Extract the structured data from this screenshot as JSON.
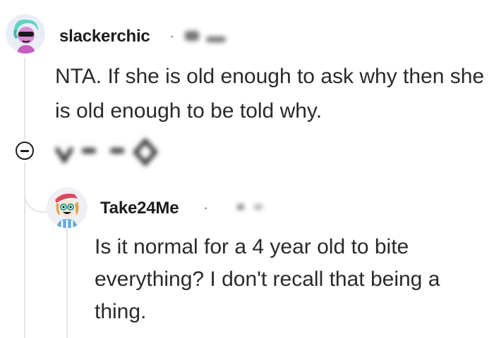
{
  "comments": [
    {
      "username": "slackerchic",
      "separator": "·",
      "text": "NTA. If she is old enough to ask why then she is old enough to be told why."
    },
    {
      "username": "Take24Me",
      "separator": "·",
      "text": "Is it normal for a 4 year old to bite everything? I don't recall that being a thing."
    }
  ],
  "icons": {
    "collapse": "minus-circle-icon",
    "upvote": "upvote-icon",
    "downvote": "downvote-icon",
    "reply": "reply-icon",
    "award": "award-icon"
  },
  "colors": {
    "text": "#1c1c1c",
    "thread_line": "#e5e5e5",
    "meta": "#7c7c7c"
  }
}
